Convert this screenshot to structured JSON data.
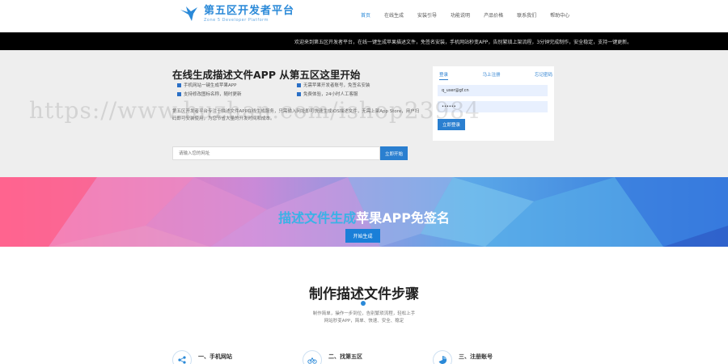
{
  "header": {
    "logo_title": "第五区开发者平台",
    "logo_subtitle": "Zone 5 Developer Platform",
    "nav": [
      "首页",
      "在线生成",
      "安装引导",
      "功能说明",
      "产品价格",
      "联系我们",
      "帮助中心"
    ]
  },
  "ticker": {
    "text": "欢迎来到第五区开发者平台，在线一键生成苹果描述文件，免签名安装，手机网站秒变APP，告别繁琐上架流程，3分钟完成制作，安全稳定，支持一键更新。"
  },
  "hero": {
    "title": "在线生成描述文件APP 从第五区这里开始",
    "features": [
      "手机网站一键生成苹果APP",
      "无需苹果开发者账号，免签名安装",
      "支持修改图标名称，随时更新",
      "免费体验，24小时人工客服"
    ],
    "description": "第五区开发者平台专注于描述文件APP在线生成服务，只需输入网址即可快速生成iOS描述文件，无需上架App Store，用户扫码即可安装使用，为您节省大量的开发时间和成本。",
    "search_placeholder": "请输入您的网址",
    "search_button": "立即开始"
  },
  "login": {
    "tabs": [
      "登录",
      "马上注册",
      "忘记密码"
    ],
    "username": "q_user@gf.cn",
    "password": "••••••",
    "button": "立即登录"
  },
  "banner": {
    "title_highlight": "描述文件生成",
    "title_rest": "苹果APP免签名",
    "button": "开始生成"
  },
  "steps": {
    "title": "制作描述文件步骤",
    "desc_line1": "制作简单，操作一步到位，告别繁琐流程，轻松上手",
    "desc_line2": "网站秒变APP，简单、快速、安全、稳定",
    "items": [
      {
        "title": "一、手机网站",
        "icon": "share-icon"
      },
      {
        "title": "二、找第五区",
        "icon": "bike-icon"
      },
      {
        "title": "三、注册账号",
        "icon": "chart-icon"
      }
    ]
  },
  "watermark": "https://www.huzhan.com/ishop23984",
  "colors": {
    "brand": "#2a89d8",
    "button": "#2a7fd0",
    "ticker_bg": "#000000",
    "hero_bg": "#eeeeee"
  }
}
